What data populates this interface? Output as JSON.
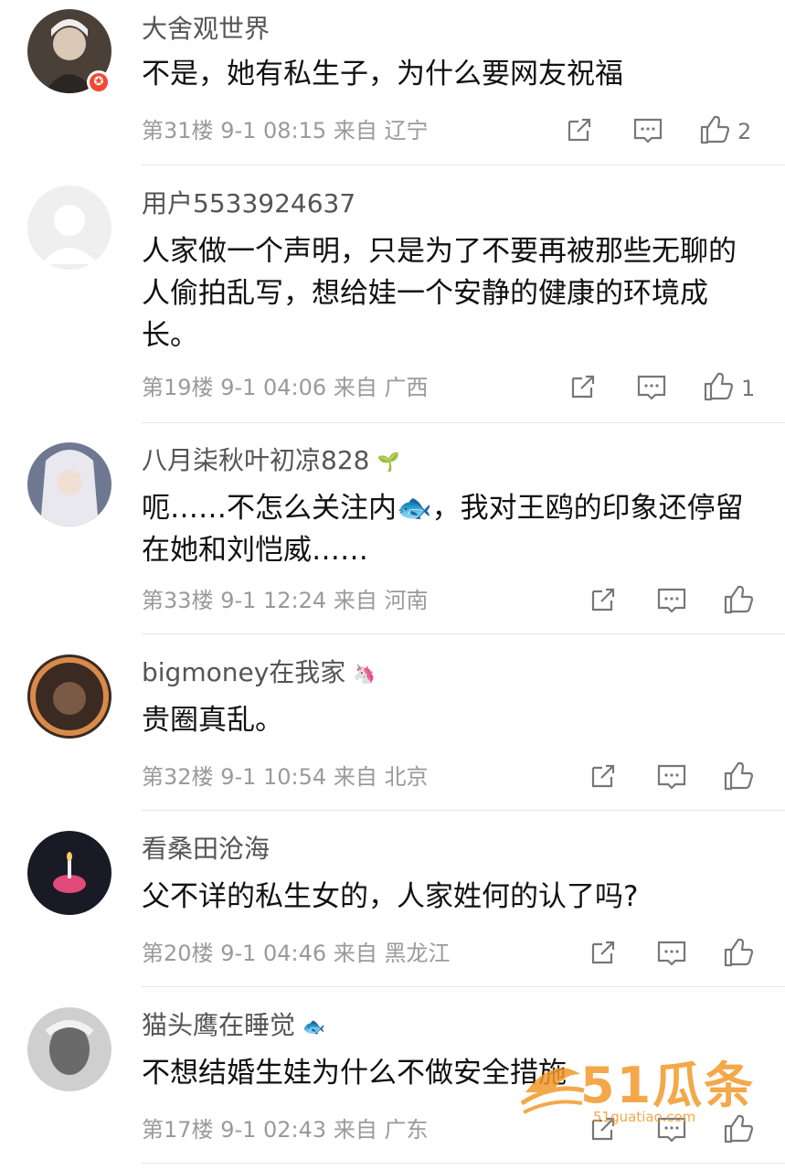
{
  "comments": [
    {
      "username": "大舍观世界",
      "text": "不是，她有私生子，为什么要网友祝福",
      "floor": "第31楼",
      "time": "9-1 08:15",
      "source": "来自 辽宁",
      "likes": "2"
    },
    {
      "username": "用户5533924637",
      "text": "人家做一个声明，只是为了不要再被那些无聊的人偷拍乱写，想给娃一个安静的健康的环境成长。",
      "floor": "第19楼",
      "time": "9-1 04:06",
      "source": "来自 广西",
      "likes": "1"
    },
    {
      "username": "八月柒秋叶初凉828",
      "text": "呃……不怎么关注内🐟，我对王鸥的印象还停留在她和刘恺威……",
      "floor": "第33楼",
      "time": "9-1 12:24",
      "source": "来自 河南",
      "likes": ""
    },
    {
      "username": "bigmoney在我家",
      "text": "贵圈真乱。",
      "floor": "第32楼",
      "time": "9-1 10:54",
      "source": "来自 北京",
      "likes": ""
    },
    {
      "username": "看桑田沧海",
      "text": "父不详的私生女的，人家姓何的认了吗?",
      "floor": "第20楼",
      "time": "9-1 04:46",
      "source": "来自 黑龙江",
      "likes": ""
    },
    {
      "username": "猫头鹰在睡觉",
      "text": "不想结婚生娃为什么不做安全措施",
      "floor": "第17楼",
      "time": "9-1 02:43",
      "source": "来自 广东",
      "likes": ""
    }
  ],
  "watermark": {
    "brand": "51瓜条",
    "site": "51guatiao.com"
  },
  "colors": {
    "meta": "#9a9a9a",
    "name": "#555555",
    "text": "#111111",
    "badge": "#f04a33",
    "watermark": "#f39a2b"
  },
  "icons": {
    "share": "share-icon",
    "comment": "comment-icon",
    "like": "thumbs-up-icon"
  }
}
